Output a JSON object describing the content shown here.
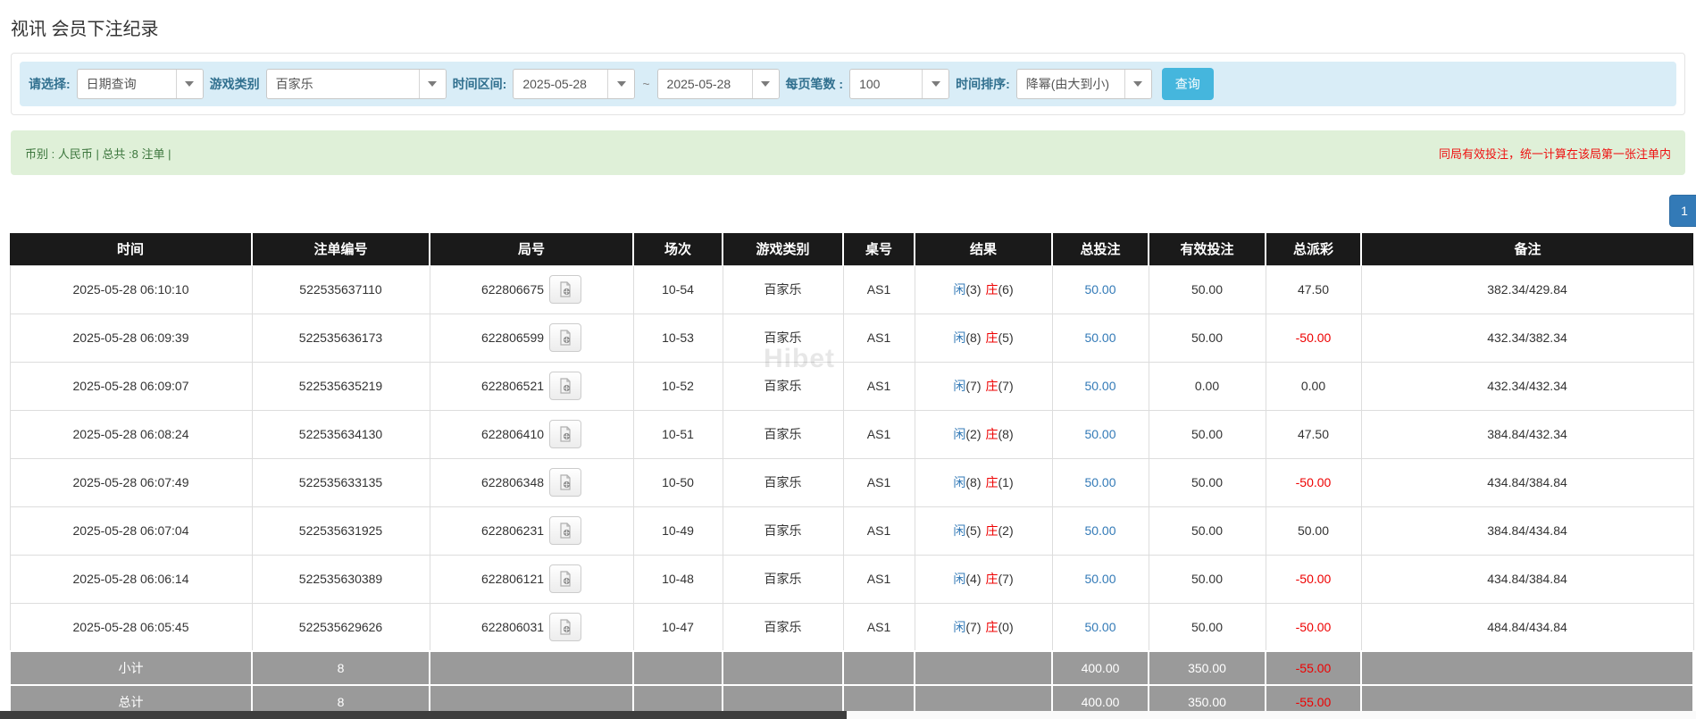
{
  "page": {
    "title": "视讯 会员下注纪录"
  },
  "colors": {
    "accent_blue": "#337ab7",
    "negative_red": "#ee0000",
    "filter_bg": "#d9edf7",
    "summary_bg": "#dff0d8",
    "header_bg": "#1a1a1a",
    "footer_bg": "#9a9a9a",
    "button_cyan": "#45b6dd"
  },
  "filters": {
    "select_label": "请选择:",
    "select_value": "日期查询",
    "game_type_label": "游戏类别",
    "game_type_value": "百家乐",
    "time_range_label": "时间区间:",
    "date_from": "2025-05-28",
    "tilde": "~",
    "date_to": "2025-05-28",
    "page_size_label": "每页笔数 :",
    "page_size_value": "100",
    "sort_label": "时间排序:",
    "sort_value": "降幂(由大到小)",
    "search_button": "查询"
  },
  "summary": {
    "left": "币别 : 人民币 | 总共 :8 注单 |",
    "right": "同局有效投注，统一计算在该局第一张注单内"
  },
  "pagination": {
    "current": "1"
  },
  "watermark": "Hibet",
  "table": {
    "headers": [
      "时间",
      "注单编号",
      "局号",
      "场次",
      "游戏类别",
      "桌号",
      "结果",
      "总投注",
      "有效投注",
      "总派彩",
      "备注"
    ],
    "rows": [
      {
        "time": "2025-05-28 06:10:10",
        "bet_id": "522535637110",
        "round_id": "622806675",
        "session": "10-54",
        "game": "百家乐",
        "table_no": "AS1",
        "p_label": "闲",
        "p_num": "(3)",
        "b_label": "庄",
        "b_num": "(6)",
        "total_bet": "50.00",
        "valid_bet": "50.00",
        "payout": "47.50",
        "remark": "382.34/429.84"
      },
      {
        "time": "2025-05-28 06:09:39",
        "bet_id": "522535636173",
        "round_id": "622806599",
        "session": "10-53",
        "game": "百家乐",
        "table_no": "AS1",
        "p_label": "闲",
        "p_num": "(8)",
        "b_label": "庄",
        "b_num": "(5)",
        "total_bet": "50.00",
        "valid_bet": "50.00",
        "payout": "-50.00",
        "remark": "432.34/382.34"
      },
      {
        "time": "2025-05-28 06:09:07",
        "bet_id": "522535635219",
        "round_id": "622806521",
        "session": "10-52",
        "game": "百家乐",
        "table_no": "AS1",
        "p_label": "闲",
        "p_num": "(7)",
        "b_label": "庄",
        "b_num": "(7)",
        "total_bet": "50.00",
        "valid_bet": "0.00",
        "payout": "0.00",
        "remark": "432.34/432.34"
      },
      {
        "time": "2025-05-28 06:08:24",
        "bet_id": "522535634130",
        "round_id": "622806410",
        "session": "10-51",
        "game": "百家乐",
        "table_no": "AS1",
        "p_label": "闲",
        "p_num": "(2)",
        "b_label": "庄",
        "b_num": "(8)",
        "total_bet": "50.00",
        "valid_bet": "50.00",
        "payout": "47.50",
        "remark": "384.84/432.34"
      },
      {
        "time": "2025-05-28 06:07:49",
        "bet_id": "522535633135",
        "round_id": "622806348",
        "session": "10-50",
        "game": "百家乐",
        "table_no": "AS1",
        "p_label": "闲",
        "p_num": "(8)",
        "b_label": "庄",
        "b_num": "(1)",
        "total_bet": "50.00",
        "valid_bet": "50.00",
        "payout": "-50.00",
        "remark": "434.84/384.84"
      },
      {
        "time": "2025-05-28 06:07:04",
        "bet_id": "522535631925",
        "round_id": "622806231",
        "session": "10-49",
        "game": "百家乐",
        "table_no": "AS1",
        "p_label": "闲",
        "p_num": "(5)",
        "b_label": "庄",
        "b_num": "(2)",
        "total_bet": "50.00",
        "valid_bet": "50.00",
        "payout": "50.00",
        "remark": "384.84/434.84"
      },
      {
        "time": "2025-05-28 06:06:14",
        "bet_id": "522535630389",
        "round_id": "622806121",
        "session": "10-48",
        "game": "百家乐",
        "table_no": "AS1",
        "p_label": "闲",
        "p_num": "(4)",
        "b_label": "庄",
        "b_num": "(7)",
        "total_bet": "50.00",
        "valid_bet": "50.00",
        "payout": "-50.00",
        "remark": "434.84/384.84"
      },
      {
        "time": "2025-05-28 06:05:45",
        "bet_id": "522535629626",
        "round_id": "622806031",
        "session": "10-47",
        "game": "百家乐",
        "table_no": "AS1",
        "p_label": "闲",
        "p_num": "(7)",
        "b_label": "庄",
        "b_num": "(0)",
        "total_bet": "50.00",
        "valid_bet": "50.00",
        "payout": "-50.00",
        "remark": "484.84/434.84"
      }
    ],
    "subtotal": {
      "label": "小计",
      "count": "8",
      "total_bet": "400.00",
      "valid_bet": "350.00",
      "payout": "-55.00"
    },
    "total": {
      "label": "总计",
      "count": "8",
      "total_bet": "400.00",
      "valid_bet": "350.00",
      "payout": "-55.00"
    }
  }
}
